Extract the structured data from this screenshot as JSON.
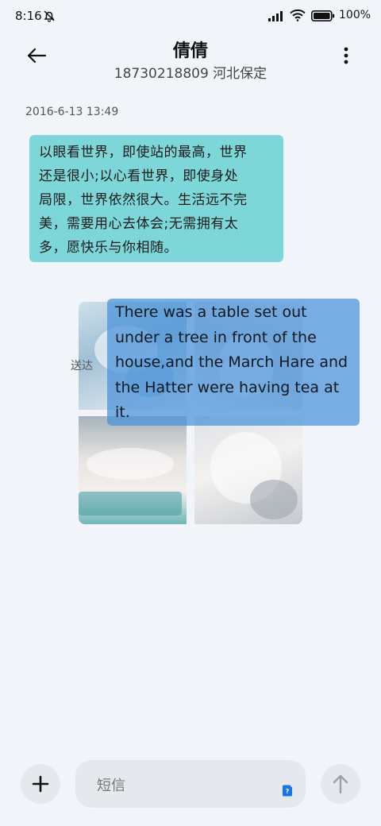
{
  "status_bar": {
    "time": "8:16",
    "battery_percent": "100%",
    "icons": [
      "bell-off-icon",
      "signal-icon",
      "wifi-icon",
      "battery-icon"
    ]
  },
  "header": {
    "contact_name": "倩倩",
    "contact_subtitle": "18730218809 河北保定",
    "back_icon": "arrow-left-icon",
    "more_icon": "more-vertical-icon"
  },
  "conversation": {
    "timestamp": "2016-6-13 13:49",
    "incoming_message": {
      "lines": [
        "以眼看世界，即使站的最高，世界",
        "还是很小;以心看世界，即使身处",
        "局限，世界依然很大。生活远不完",
        "美，需要用心去体会;无需拥有太",
        "多，愿快乐与你相随。"
      ],
      "color": "#7dd7d8"
    },
    "outgoing_status": "送达",
    "outgoing_message": {
      "lines": [
        "There was a table set out",
        "under a tree in front of the",
        "house,and the March Hare and",
        "the Hatter were having tea at",
        "it."
      ],
      "color": "#4892da"
    },
    "photo_count": 4
  },
  "composer": {
    "placeholder": "短信",
    "add_icon": "plus-icon",
    "send_icon": "arrow-up-icon",
    "sim_badge": "?"
  }
}
